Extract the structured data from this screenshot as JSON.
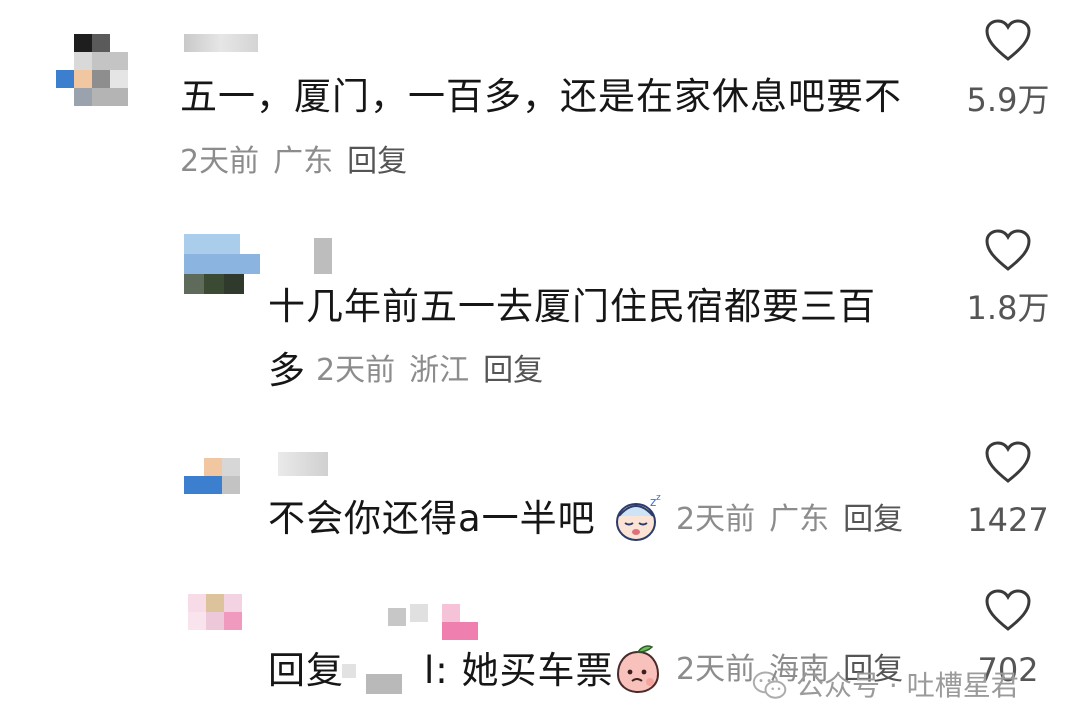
{
  "comments": [
    {
      "text": "五一，厦门，一百多，还是在家休息吧要不",
      "time": "2天前",
      "location": "广东",
      "reply_label": "回复",
      "likes": "5.9万"
    },
    {
      "text_line1": "十几年前五一去厦门住民宿都要三百",
      "text_line2": "多",
      "time": "2天前",
      "location": "浙江",
      "reply_label": "回复",
      "likes": "1.8万"
    },
    {
      "text": "不会你还得a一半吧",
      "time": "2天前",
      "location": "广东",
      "reply_label": "回复",
      "likes": "1427"
    },
    {
      "text_prefix": "回复",
      "text_suffix": "l: 她买车票",
      "time": "2天前",
      "location": "海南",
      "reply_label": "回复",
      "likes": "702"
    }
  ],
  "watermark": {
    "text": "公众号 · 吐槽星君"
  },
  "icons": {
    "like": "heart-outline-icon",
    "emoji_3": "sleeping-face-emoji",
    "emoji_4": "peach-face-emoji",
    "watermark": "wechat-icon"
  }
}
